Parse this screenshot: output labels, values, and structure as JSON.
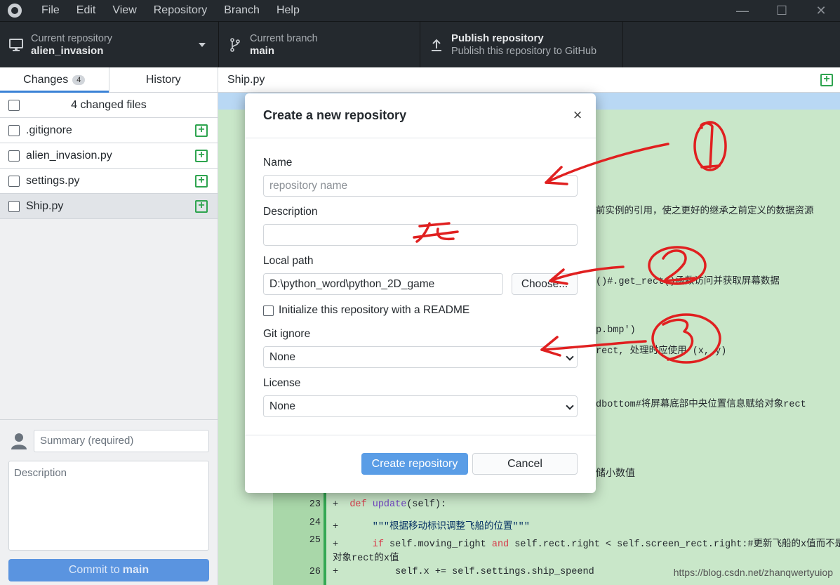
{
  "menu": [
    "File",
    "Edit",
    "View",
    "Repository",
    "Branch",
    "Help"
  ],
  "window_controls": {
    "minimize": "—",
    "maximize": "☐",
    "close": "✕"
  },
  "toolbar": {
    "repo_label": "Current repository",
    "repo_value": "alien_invasion",
    "branch_label": "Current branch",
    "branch_value": "main",
    "publish_title": "Publish repository",
    "publish_subtitle": "Publish this repository to GitHub"
  },
  "sidebar": {
    "tab_changes": "Changes",
    "tab_changes_count": "4",
    "tab_history": "History",
    "changed_files_label": "4 changed files",
    "files": [
      ".gitignore",
      "alien_invasion.py",
      "settings.py",
      "Ship.py"
    ],
    "summary_placeholder": "Summary (required)",
    "description_placeholder": "Description",
    "commit_prefix": "Commit to",
    "commit_branch": "main"
  },
  "main": {
    "file_title": "Ship.py",
    "visible_fragments": {
      "f1": "前实例的引用，使之更好的继承之前定义的数据资源",
      "f2": "()#.get_rect()函数访问并获取屏幕数据",
      "f3": "p.bmp')",
      "f4": "rect, 处理时应使用 (x, y)",
      "f5": "dbottom#将屏幕底部中央位置信息赋给对象rect",
      "f6": "储小数值"
    },
    "lines": [
      {
        "no": "23",
        "text_kw": "def ",
        "text_fn": "update",
        "text_rest": "(self):"
      },
      {
        "no": "24",
        "text": "\"\"\"根据移动标识调整飞船的位置\"\"\""
      },
      {
        "no": "25",
        "text_kw": "if ",
        "text_rest": "self.moving_right ",
        "text_kw2": "and",
        "text_rest2": " self.rect.right < self.screen_rect.right:#更新飞船的x值而不是",
        "wrap": "对象rect的x值"
      },
      {
        "no": "26",
        "text": "self.x += self.settings.ship_speend"
      }
    ]
  },
  "dialog": {
    "title": "Create a new repository",
    "name_label": "Name",
    "name_placeholder": "repository name",
    "description_label": "Description",
    "local_path_label": "Local path",
    "local_path_value": "D:\\python_word\\python_2D_game",
    "choose_label": "Choose...",
    "readme_label": "Initialize this repository with a README",
    "gitignore_label": "Git ignore",
    "gitignore_value": "None",
    "license_label": "License",
    "license_value": "None",
    "create_label": "Create repository",
    "cancel_label": "Cancel"
  },
  "annotations": {
    "one": "①",
    "wu": "无"
  },
  "watermark": "https://blog.csdn.net/zhanqwertyuiop",
  "colors": {
    "accent": "#3b82d6",
    "annotation": "#e02020",
    "diff_added": "#c9e7c9"
  }
}
